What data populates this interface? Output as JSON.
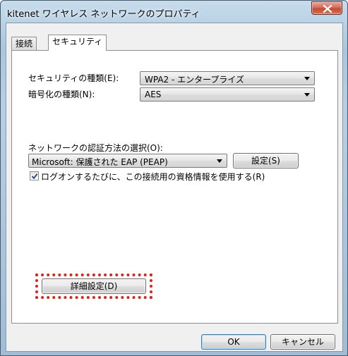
{
  "window": {
    "title": "kitenet ワイヤレス ネットワークのプロパティ",
    "close_icon": "close-x-icon",
    "close_color": "#c9472d"
  },
  "tabs": [
    {
      "label": "接続"
    },
    {
      "label": "セキュリティ"
    }
  ],
  "security": {
    "type_label": "セキュリティの種類(E):",
    "type_value": "WPA2 - エンタープライズ",
    "encryption_label": "暗号化の種類(N):",
    "encryption_value": "AES",
    "auth_label": "ネットワークの認証方法の選択(O):",
    "auth_value": "Microsoft: 保護された EAP (PEAP)",
    "settings_button": "設定(S)",
    "remember_checkbox_label": "ログオンするたびに、この接続用の資格情報を使用する(R)",
    "remember_checked": true,
    "advanced_button": "詳細設定(D)"
  },
  "highlight_color": "#e0201a",
  "footer": {
    "ok_button": "OK",
    "cancel_button": "キャンセル"
  }
}
